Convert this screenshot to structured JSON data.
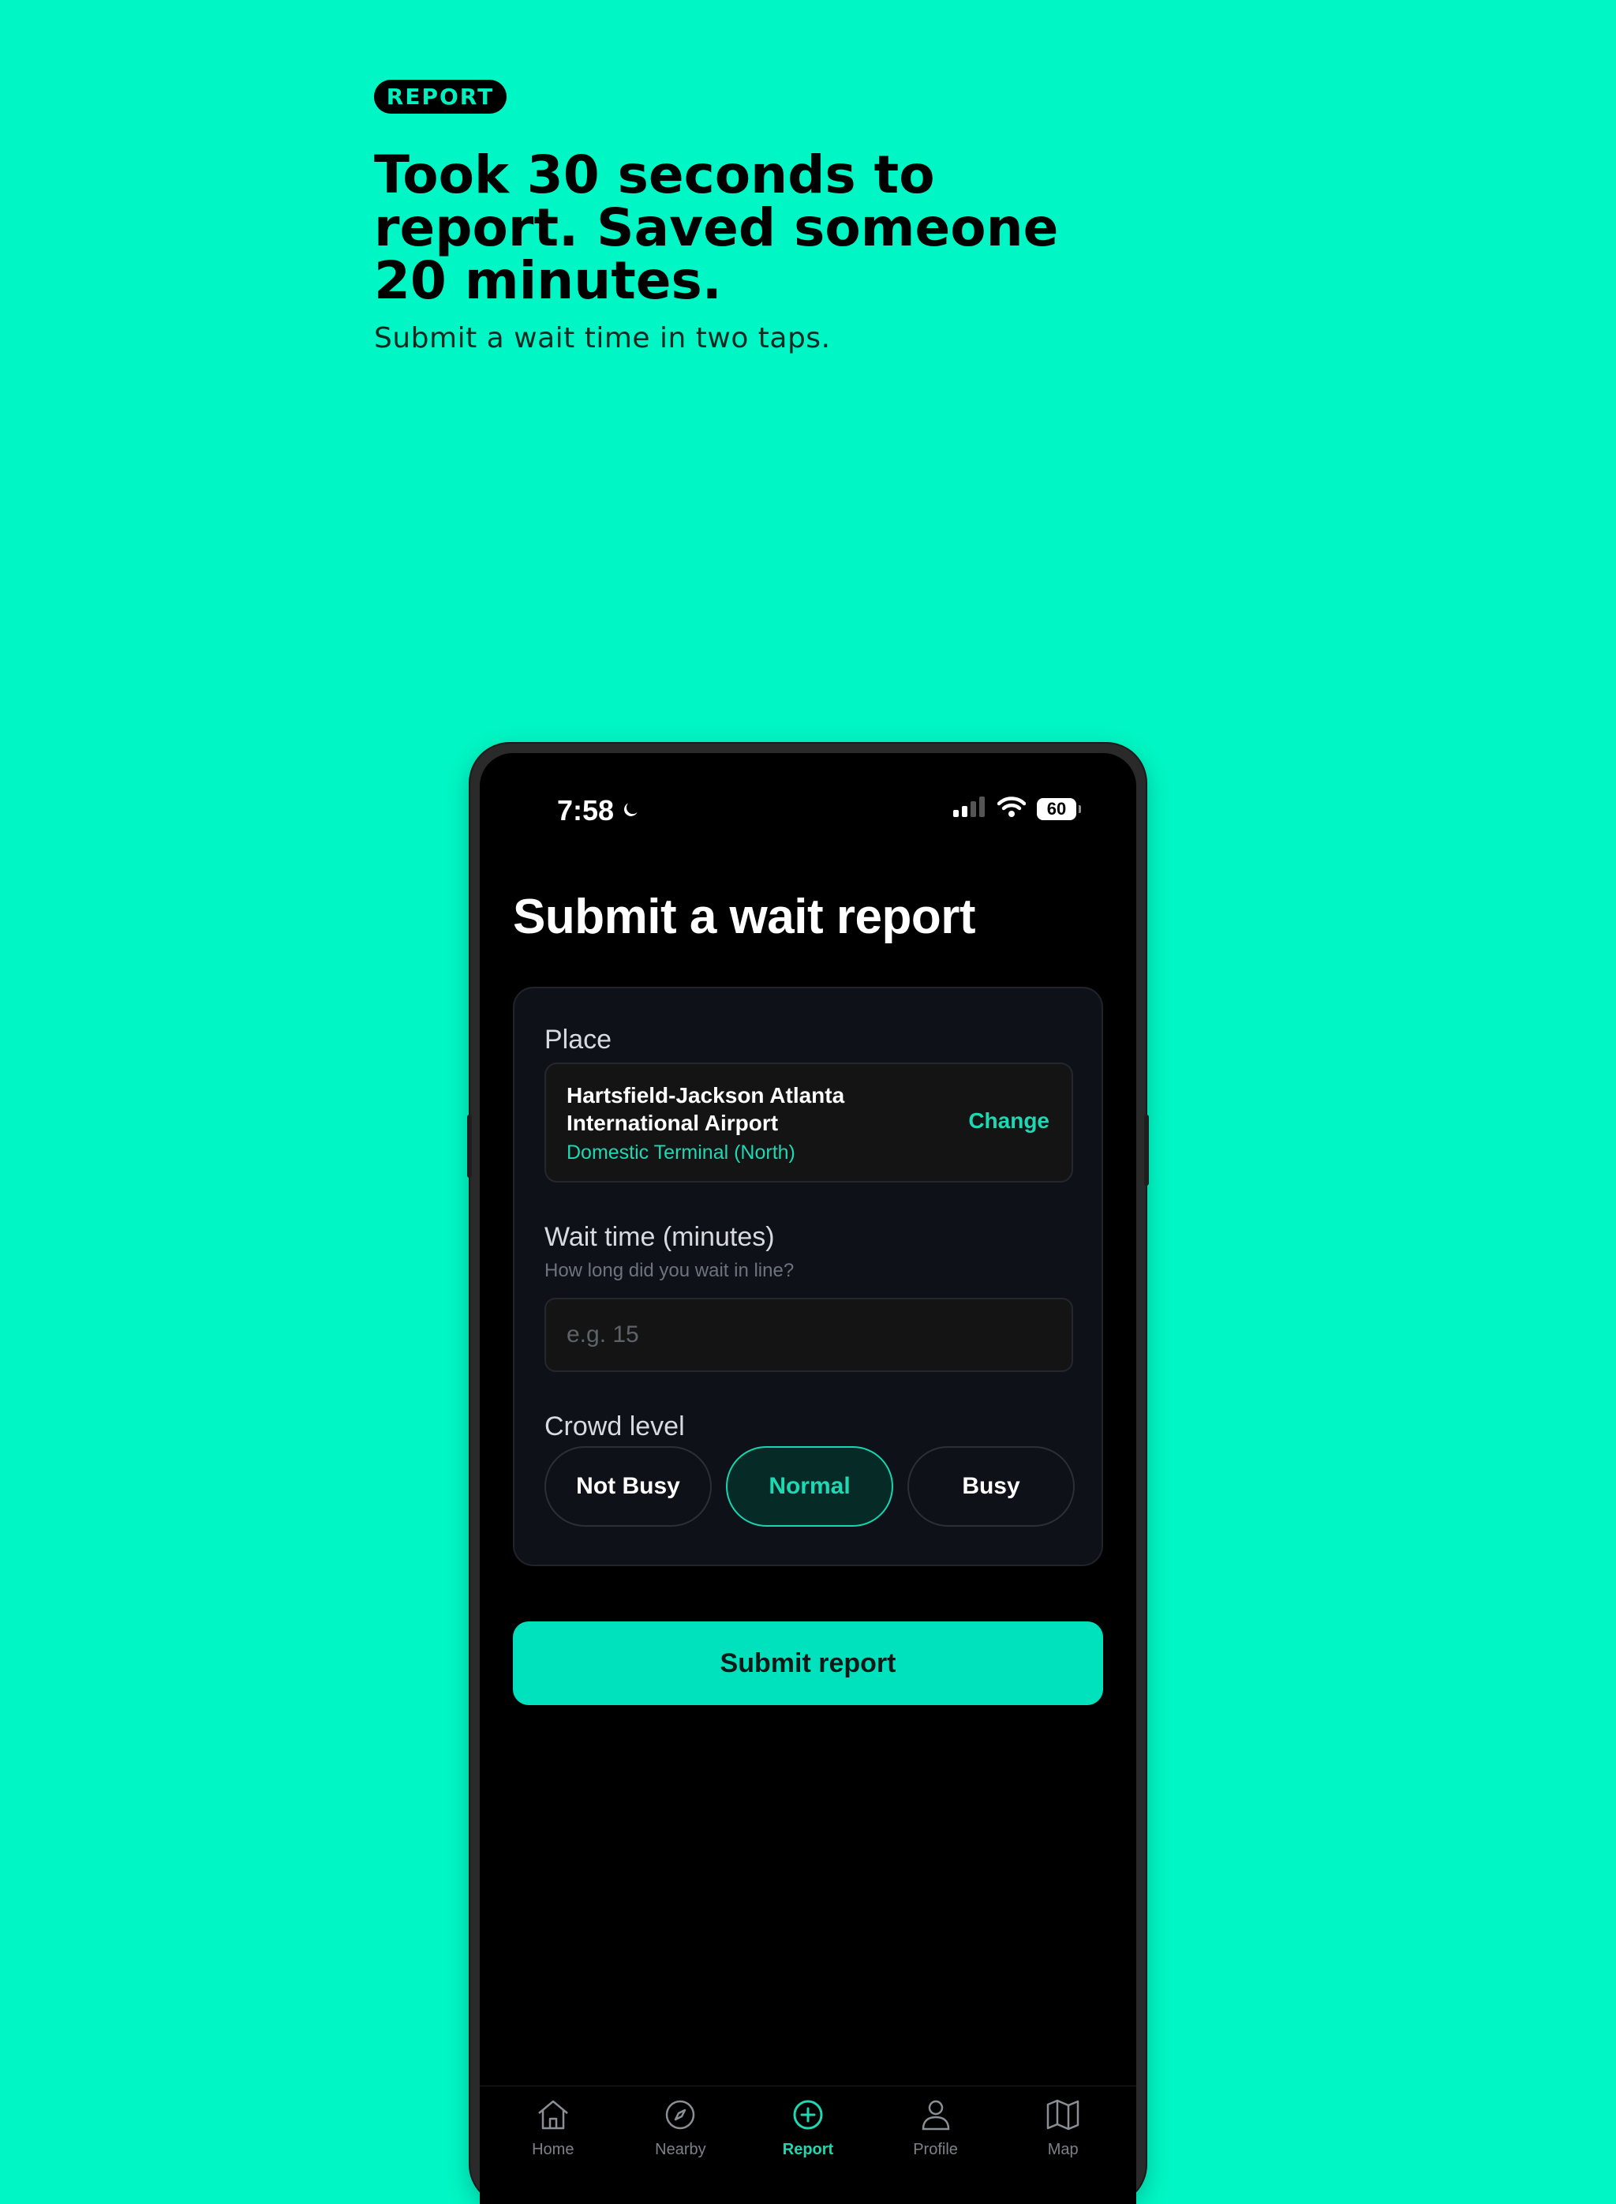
{
  "hero": {
    "badge": "REPORT",
    "headline": "Took 30 seconds to report. Saved someone 20 minutes.",
    "subheadline": "Submit a wait time in two taps."
  },
  "status_bar": {
    "time": "7:58",
    "battery": "60",
    "icons": [
      "moon-icon",
      "signal-icon",
      "wifi-icon",
      "battery-icon"
    ]
  },
  "screen": {
    "title": "Submit a wait report",
    "place": {
      "label": "Place",
      "name": "Hartsfield-Jackson Atlanta International Airport",
      "sublabel": "Domestic Terminal (North)",
      "change_label": "Change"
    },
    "wait_time": {
      "label": "Wait time (minutes)",
      "hint": "How long did you wait in line?",
      "value": "",
      "placeholder": "e.g. 15"
    },
    "crowd": {
      "label": "Crowd level",
      "options": [
        "Not Busy",
        "Normal",
        "Busy"
      ],
      "selected": "Normal"
    },
    "submit_label": "Submit report"
  },
  "tabbar": {
    "items": [
      {
        "label": "Home",
        "icon": "home-icon"
      },
      {
        "label": "Nearby",
        "icon": "compass-icon"
      },
      {
        "label": "Report",
        "icon": "plus-circle-icon"
      },
      {
        "label": "Profile",
        "icon": "person-icon"
      },
      {
        "label": "Map",
        "icon": "map-icon"
      }
    ],
    "active": "Report"
  },
  "colors": {
    "background": "#00f6c4",
    "accent": "#1ed8b3",
    "submit": "#00e2bd",
    "screen": "#000000",
    "card": "#0e1117"
  }
}
